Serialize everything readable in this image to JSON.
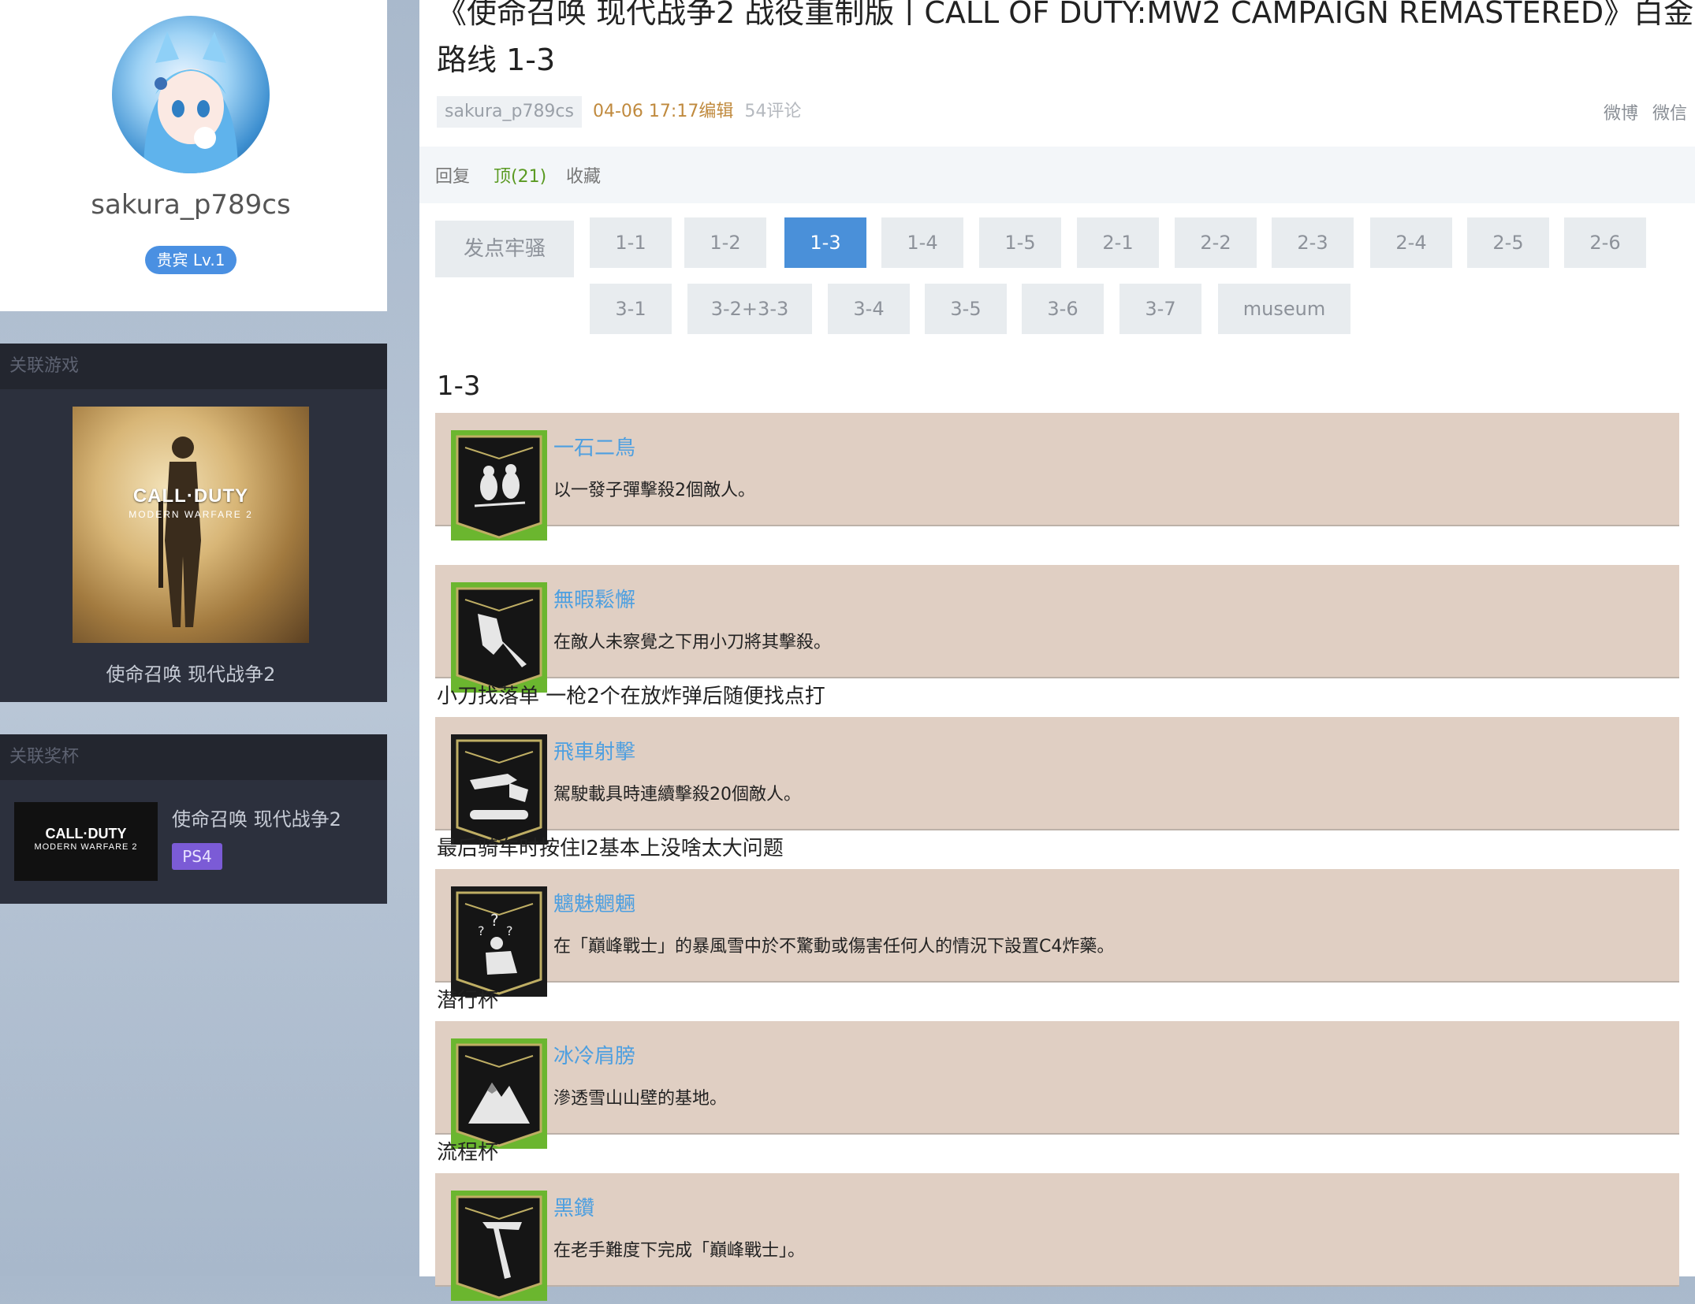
{
  "sidebar": {
    "username": "sakura_p789cs",
    "level": "贵宾 Lv.1",
    "game_panel_title": "关联游戏",
    "game_cover_title": "CALL·DUTY",
    "game_cover_subtitle": "MODERN WARFARE 2",
    "game_name": "使命召唤 现代战争2",
    "trophy_panel_title": "关联奖杯",
    "trophy_thumb_title": "CALL·DUTY",
    "trophy_thumb_subtitle": "MODERN WARFARE 2",
    "trophy_name": "使命召唤 现代战争2",
    "platform": "PS4"
  },
  "article": {
    "title": "《使命召唤 现代战争2 战役重制版丨CALL OF DUTY:MW2 CAMPAIGN REMASTERED》白金路线 1-3",
    "author": "sakura_p789cs",
    "time": "04-06 17:17编辑",
    "comments": "54评论",
    "share": [
      "微博",
      "微信"
    ],
    "actions": {
      "reply": "回复",
      "upvote": "顶(21)",
      "favorite": "收藏"
    }
  },
  "nav": {
    "rant_button": "发点牢骚",
    "tabs": [
      "1-1",
      "1-2",
      "1-3",
      "1-4",
      "1-5",
      "2-1",
      "2-2",
      "2-3",
      "2-4",
      "2-5",
      "2-6",
      "3-1",
      "3-2+3-3",
      "3-4",
      "3-5",
      "3-6",
      "3-7",
      "museum"
    ],
    "active_tab": "1-3"
  },
  "section_title": "1-3",
  "achievements": [
    {
      "name": "一石二鳥",
      "desc": "以一發子彈擊殺2個敵人。",
      "icon": "two-birds-icon",
      "frame": "#6bb62f"
    },
    {
      "name": "無暇鬆懈",
      "desc": "在敵人未察覺之下用小刀將其擊殺。",
      "icon": "knife-stab-icon",
      "frame": "#6bb62f",
      "note": "小刀找落单 一枪2个在放炸弹后随便找点打"
    },
    {
      "name": "飛車射擊",
      "desc": "駕駛載具時連續擊殺20個敵人。",
      "icon": "vehicle-shooting-icon",
      "frame": "#1a1a1a",
      "note": "最后骑车时按住l2基本上没啥太大问题"
    },
    {
      "name": "魑魅魍魎",
      "desc": "在「巔峰戰士」的暴風雪中於不驚動或傷害任何人的情況下設置C4炸藥。",
      "icon": "stealth-soldier-icon",
      "frame": "#1a1a1a",
      "note": "潜行杯"
    },
    {
      "name": "冰冷肩膀",
      "desc": "滲透雪山山壁的基地。",
      "icon": "snow-mountain-icon",
      "frame": "#6bb62f",
      "note": "流程杯"
    },
    {
      "name": "黑鑽",
      "desc": "在老手難度下完成「巔峰戰士」。",
      "icon": "ice-axe-icon",
      "frame": "#6bb62f"
    }
  ]
}
